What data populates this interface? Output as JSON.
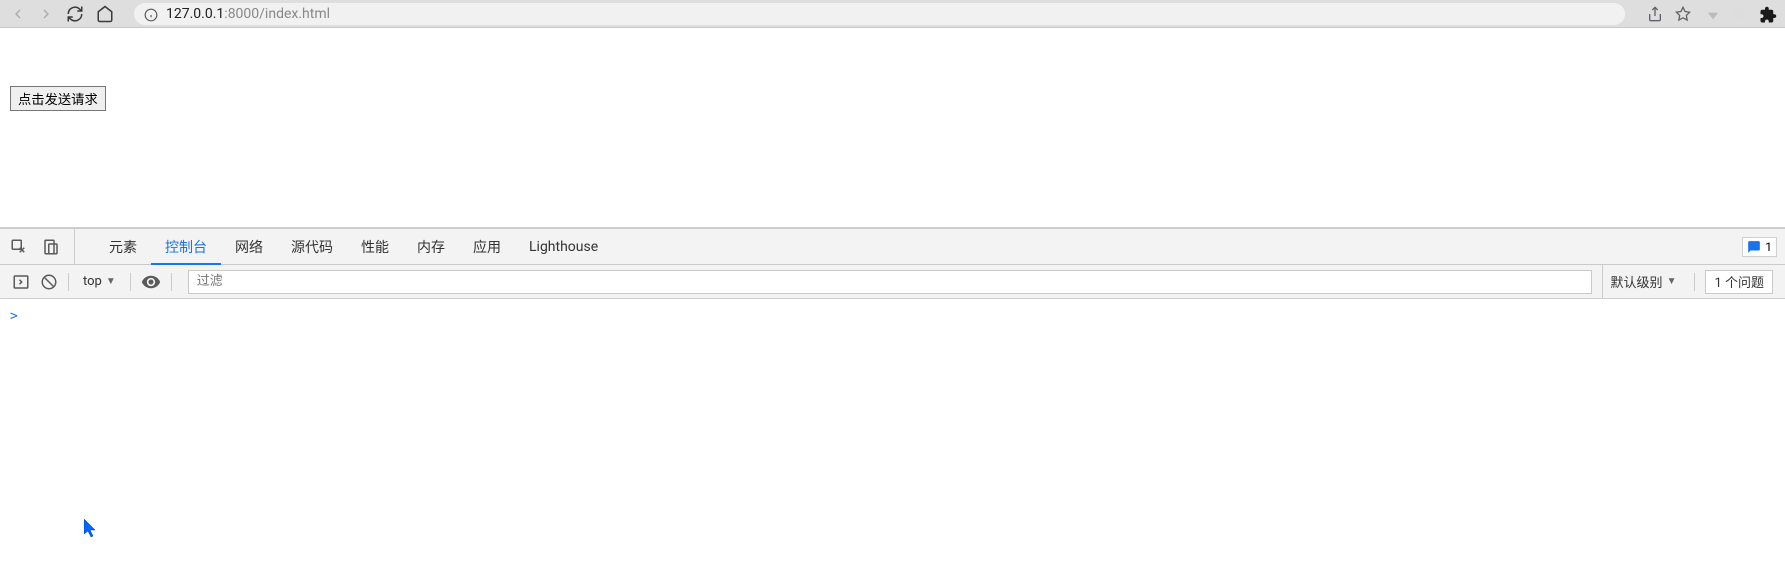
{
  "browser": {
    "url_prefix": "127.0.0.1",
    "url_suffix": ":8000/index.html"
  },
  "page": {
    "button_label": "点击发送请求"
  },
  "devtools": {
    "tabs": [
      {
        "label": "元素"
      },
      {
        "label": "控制台"
      },
      {
        "label": "网络"
      },
      {
        "label": "源代码"
      },
      {
        "label": "性能"
      },
      {
        "label": "内存"
      },
      {
        "label": "应用"
      },
      {
        "label": "Lighthouse"
      }
    ],
    "active_tab_index": 1,
    "issues_count": "1"
  },
  "console": {
    "context": "top",
    "filter_placeholder": "过滤",
    "level_label": "默认级别",
    "problems_label": "1 个问题",
    "prompt": ">"
  }
}
